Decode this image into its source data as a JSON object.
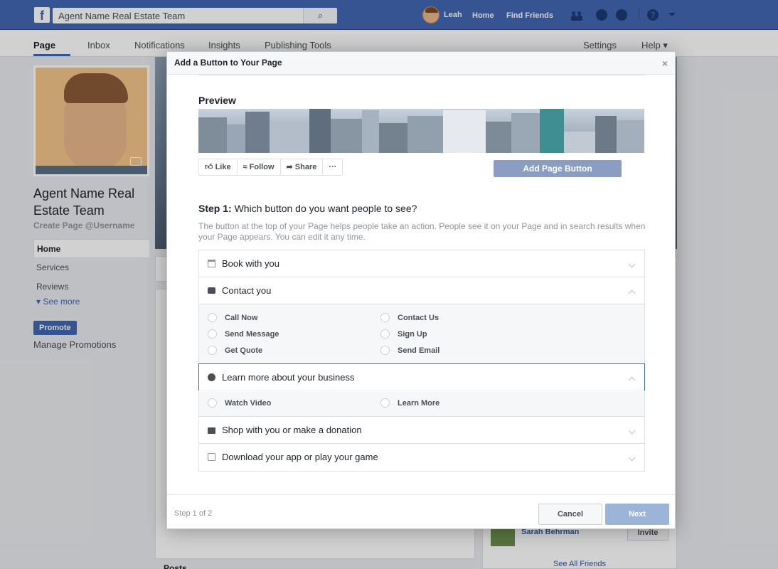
{
  "topbar": {
    "search_value": "Agent Name Real Estate Team",
    "user_name": "Leah",
    "home": "Home",
    "find_friends": "Find Friends"
  },
  "page_nav": {
    "tabs": [
      "Page",
      "Inbox",
      "Notifications",
      "Insights",
      "Publishing Tools"
    ],
    "settings": "Settings",
    "help": "Help ▾"
  },
  "sidebar": {
    "page_name": "Agent Name Real Estate Team",
    "handle": "Create Page @Username",
    "items": [
      "Home",
      "Services",
      "Reviews"
    ],
    "see_more": "See more",
    "promote": "Promote",
    "manage_promotions": "Manage Promotions"
  },
  "modal": {
    "title": "Add a Button to Your Page",
    "close": "×",
    "preview_label": "Preview",
    "actions": [
      "Like",
      "Follow",
      "Share",
      "···"
    ],
    "add_page_button": "Add Page Button",
    "step_label": "Step 1:",
    "step_question": " Which button do you want people to see?",
    "step_desc": "The button at the top of your Page helps people take an action. People see it on your Page and in search results when your Page appears. You can edit it any time.",
    "sections": [
      {
        "label": "Book with you"
      },
      {
        "label": "Contact you",
        "options": [
          "Call Now",
          "Contact Us",
          "Send Message",
          "Sign Up",
          "Get Quote",
          "Send Email"
        ]
      },
      {
        "label": "Learn more about your business",
        "options": [
          "Watch Video",
          "Learn More"
        ]
      },
      {
        "label": "Shop with you or make a donation"
      },
      {
        "label": "Download your app or play your game"
      }
    ],
    "step_count": "Step 1 of 2",
    "cancel": "Cancel",
    "next": "Next"
  },
  "background": {
    "friend_name": "Sarah Behrman",
    "invite": "Invite",
    "see_all_friends": "See All Friends",
    "posts": "Posts"
  },
  "colors": {
    "brand": "#4267b2",
    "next_disabled": "#9cb4d8",
    "add_page_btn": "#8b9dc3"
  }
}
